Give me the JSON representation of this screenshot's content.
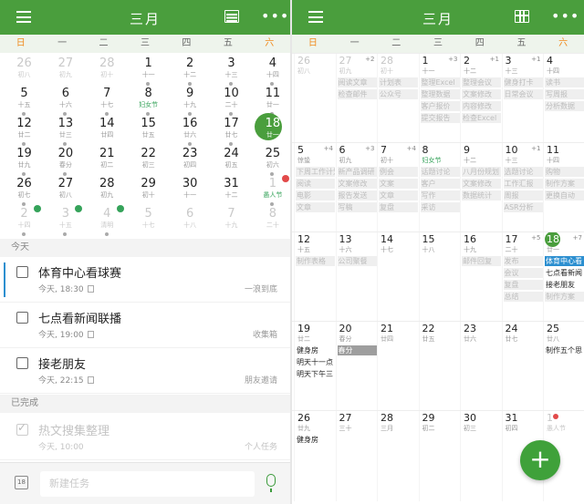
{
  "header": {
    "title": "三月"
  },
  "weekdays": [
    "日",
    "一",
    "二",
    "三",
    "四",
    "五",
    "六"
  ],
  "month_grid": [
    [
      {
        "n": "26",
        "l": "初八",
        "o": true
      },
      {
        "n": "27",
        "l": "初九",
        "o": true
      },
      {
        "n": "28",
        "l": "初十",
        "o": true
      },
      {
        "n": "1",
        "l": "十一"
      },
      {
        "n": "2",
        "l": "十二"
      },
      {
        "n": "3",
        "l": "十三"
      },
      {
        "n": "4",
        "l": "十四"
      }
    ],
    [
      {
        "n": "5",
        "l": "十五"
      },
      {
        "n": "6",
        "l": "十六"
      },
      {
        "n": "7",
        "l": "十七"
      },
      {
        "n": "8",
        "l": "妇女节",
        "fest": true
      },
      {
        "n": "9",
        "l": "十九"
      },
      {
        "n": "10",
        "l": "二十"
      },
      {
        "n": "11",
        "l": "廿一"
      }
    ],
    [
      {
        "n": "12",
        "l": "廿二"
      },
      {
        "n": "13",
        "l": "廿三"
      },
      {
        "n": "14",
        "l": "廿四"
      },
      {
        "n": "15",
        "l": "廿五"
      },
      {
        "n": "16",
        "l": "廿六"
      },
      {
        "n": "17",
        "l": "廿七"
      },
      {
        "n": "18",
        "l": "廿一",
        "today": true
      }
    ],
    [
      {
        "n": "19",
        "l": "廿九"
      },
      {
        "n": "20",
        "l": "春分"
      },
      {
        "n": "21",
        "l": "初二"
      },
      {
        "n": "22",
        "l": "初三"
      },
      {
        "n": "23",
        "l": "初四"
      },
      {
        "n": "24",
        "l": "初五"
      },
      {
        "n": "25",
        "l": "初六"
      }
    ],
    [
      {
        "n": "26",
        "l": "初七"
      },
      {
        "n": "27",
        "l": "初八"
      },
      {
        "n": "28",
        "l": "初九"
      },
      {
        "n": "29",
        "l": "初十"
      },
      {
        "n": "30",
        "l": "十一"
      },
      {
        "n": "31",
        "l": "十二"
      },
      {
        "n": "1",
        "l": "愚人节",
        "o": true,
        "fest": true
      }
    ],
    [
      {
        "n": "2",
        "l": "十四",
        "o": true
      },
      {
        "n": "3",
        "l": "十五",
        "o": true
      },
      {
        "n": "4",
        "l": "清明",
        "o": true
      },
      {
        "n": "5",
        "l": "十七",
        "o": true
      },
      {
        "n": "6",
        "l": "十八",
        "o": true
      },
      {
        "n": "7",
        "l": "十九",
        "o": true
      },
      {
        "n": "8",
        "l": "二十",
        "o": true
      }
    ]
  ],
  "today_section": "今天",
  "tasks": [
    {
      "title": "体育中心看球赛",
      "time": "今天, 18:30",
      "list": "一浪到底"
    },
    {
      "title": "七点看新闻联播",
      "time": "今天, 19:00",
      "list": "收集箱"
    },
    {
      "title": "接老朋友",
      "time": "今天, 22:15",
      "list": "朋友邀请"
    }
  ],
  "done_section": "已完成",
  "done_tasks": [
    {
      "title": "热文搜集整理",
      "time": "今天, 10:00",
      "list": "个人任务"
    }
  ],
  "input_placeholder": "新建任务",
  "week_rows": [
    [
      {
        "n": "26",
        "l": "初八",
        "o": true,
        "ev": []
      },
      {
        "n": "27",
        "l": "初九",
        "o": true,
        "cnt": "+2",
        "ev": [
          {
            "t": "阅读文章"
          },
          {
            "t": "检查邮件"
          }
        ]
      },
      {
        "n": "28",
        "l": "初十",
        "o": true,
        "ev": [
          {
            "t": "计划表"
          },
          {
            "t": "公众号"
          }
        ]
      },
      {
        "n": "1",
        "l": "十一",
        "cnt": "+3",
        "ev": [
          {
            "t": "整理Excel"
          },
          {
            "t": "整理数据"
          },
          {
            "t": "客户报价"
          },
          {
            "t": "提交报告"
          }
        ]
      },
      {
        "n": "2",
        "l": "十二",
        "cnt": "+1",
        "ev": [
          {
            "t": "整理会议"
          },
          {
            "t": "文案修改"
          },
          {
            "t": "内容修改"
          },
          {
            "t": "检查Excel"
          }
        ]
      },
      {
        "n": "3",
        "l": "十三",
        "cnt": "+1",
        "ev": [
          {
            "t": "健身打卡"
          },
          {
            "t": "日常会议"
          }
        ]
      },
      {
        "n": "4",
        "l": "十四",
        "ev": [
          {
            "t": "读书"
          },
          {
            "t": "写周报"
          },
          {
            "t": "分析数据"
          }
        ]
      }
    ],
    [
      {
        "n": "5",
        "l": "惊蛰",
        "cnt": "+4",
        "ev": [
          {
            "t": "下周工作计划"
          },
          {
            "t": "阅读"
          },
          {
            "t": "电影"
          },
          {
            "t": "文章"
          }
        ]
      },
      {
        "n": "6",
        "l": "初九",
        "cnt": "+3",
        "ev": [
          {
            "t": "新产品调研"
          },
          {
            "t": "文案修改"
          },
          {
            "t": "报告发送"
          },
          {
            "t": "写稿"
          }
        ]
      },
      {
        "n": "7",
        "l": "初十",
        "cnt": "+4",
        "ev": [
          {
            "t": "例会"
          },
          {
            "t": "文案"
          },
          {
            "t": "文章"
          },
          {
            "t": "复盘"
          }
        ]
      },
      {
        "n": "8",
        "l": "妇女节",
        "fest": true,
        "ev": [
          {
            "t": "话题讨论"
          },
          {
            "t": "客户"
          },
          {
            "t": "写作"
          },
          {
            "t": "采访"
          }
        ]
      },
      {
        "n": "9",
        "l": "十二",
        "ev": [
          {
            "t": "八月份规划"
          },
          {
            "t": "文案修改"
          },
          {
            "t": "数据统计"
          }
        ]
      },
      {
        "n": "10",
        "l": "十三",
        "cnt": "+1",
        "ev": [
          {
            "t": "选题讨论"
          },
          {
            "t": "工作汇报"
          },
          {
            "t": "周报"
          },
          {
            "t": "ASR分析"
          }
        ]
      },
      {
        "n": "11",
        "l": "十四",
        "ev": [
          {
            "t": "购物"
          },
          {
            "t": "制作方案"
          },
          {
            "t": "更换自动"
          }
        ]
      }
    ],
    [
      {
        "n": "12",
        "l": "十五",
        "ev": [
          {
            "t": "制作表格"
          }
        ]
      },
      {
        "n": "13",
        "l": "十六",
        "ev": [
          {
            "t": "公司聚餐"
          }
        ]
      },
      {
        "n": "14",
        "l": "十七",
        "ev": []
      },
      {
        "n": "15",
        "l": "十八",
        "ev": []
      },
      {
        "n": "16",
        "l": "十九",
        "ev": [
          {
            "t": "邮件回复"
          }
        ]
      },
      {
        "n": "17",
        "l": "二十",
        "cnt": "+5",
        "ev": [
          {
            "t": "发布"
          },
          {
            "t": "会议"
          },
          {
            "t": "复盘"
          },
          {
            "t": "总结"
          }
        ]
      },
      {
        "n": "18",
        "l": "廿一",
        "today": true,
        "cnt": "+7",
        "ev": [
          {
            "t": "体育中心看",
            "k": "blue"
          },
          {
            "t": "七点看新闻",
            "k": "act"
          },
          {
            "t": "接老朋友",
            "k": "act"
          },
          {
            "t": "制作方案"
          }
        ]
      }
    ],
    [
      {
        "n": "19",
        "l": "廿二",
        "ev": [
          {
            "t": "健身房",
            "k": "act"
          },
          {
            "t": "明天十一点",
            "k": "act"
          },
          {
            "t": "明天下午三",
            "k": "act"
          }
        ]
      },
      {
        "n": "20",
        "l": "春分",
        "ev": [
          {
            "t": "春分",
            "k": "dark"
          }
        ]
      },
      {
        "n": "21",
        "l": "廿四",
        "ev": []
      },
      {
        "n": "22",
        "l": "廿五",
        "ev": []
      },
      {
        "n": "23",
        "l": "廿六",
        "ev": []
      },
      {
        "n": "24",
        "l": "廿七",
        "ev": []
      },
      {
        "n": "25",
        "l": "廿八",
        "ev": [
          {
            "t": "制作五个思",
            "k": "act"
          }
        ]
      }
    ],
    [
      {
        "n": "26",
        "l": "廿九",
        "ev": [
          {
            "t": "健身房",
            "k": "act"
          }
        ]
      },
      {
        "n": "27",
        "l": "三十",
        "ev": []
      },
      {
        "n": "28",
        "l": "三月",
        "ev": []
      },
      {
        "n": "29",
        "l": "初二",
        "ev": []
      },
      {
        "n": "30",
        "l": "初三",
        "ev": []
      },
      {
        "n": "31",
        "l": "初四",
        "ev": []
      },
      {
        "n": "1",
        "l": "愚人节",
        "o": true,
        "fest": true,
        "badge": true,
        "ev": []
      }
    ]
  ],
  "fab_label": "+",
  "colors": {
    "accent": "#4a9e3d",
    "weekend": "#f08a1c",
    "active_task": "#2c8fd0"
  }
}
